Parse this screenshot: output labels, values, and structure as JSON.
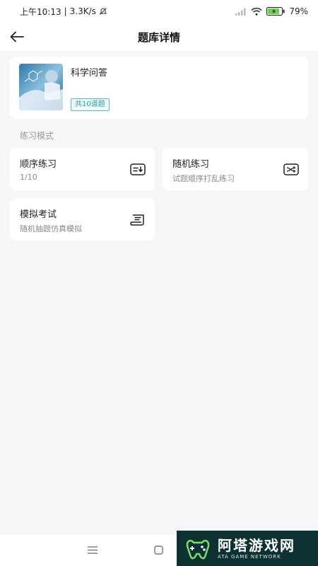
{
  "status_bar": {
    "time": "上午10:13",
    "separator": "|",
    "speed": "3.3K/s",
    "battery_percent": "79%",
    "icons": [
      "mute-bell-icon",
      "signal-icon",
      "wifi-icon",
      "battery-icon"
    ]
  },
  "header": {
    "title": "题库详情",
    "back_icon": "arrow-left-icon"
  },
  "bank": {
    "name": "科学问答",
    "count_label": "共10道题"
  },
  "section": {
    "label": "练习模式"
  },
  "modes": [
    {
      "title": "顺序练习",
      "subtitle": "1/10",
      "icon": "sequence-icon"
    },
    {
      "title": "随机练习",
      "subtitle": "试题顺序打乱练习",
      "icon": "shuffle-icon"
    },
    {
      "title": "模拟考试",
      "subtitle": "随机抽题仿真模拟",
      "icon": "exam-scroll-icon"
    }
  ],
  "nav": {
    "icons": [
      "menu-icon",
      "home-square-icon"
    ]
  },
  "watermark": {
    "main": "阿塔游戏网",
    "sub": "ATA GAME NETWORK"
  },
  "colors": {
    "background": "#f5f6f8",
    "badge_border": "#58b9c4",
    "watermark_bg": "#0d3130"
  }
}
